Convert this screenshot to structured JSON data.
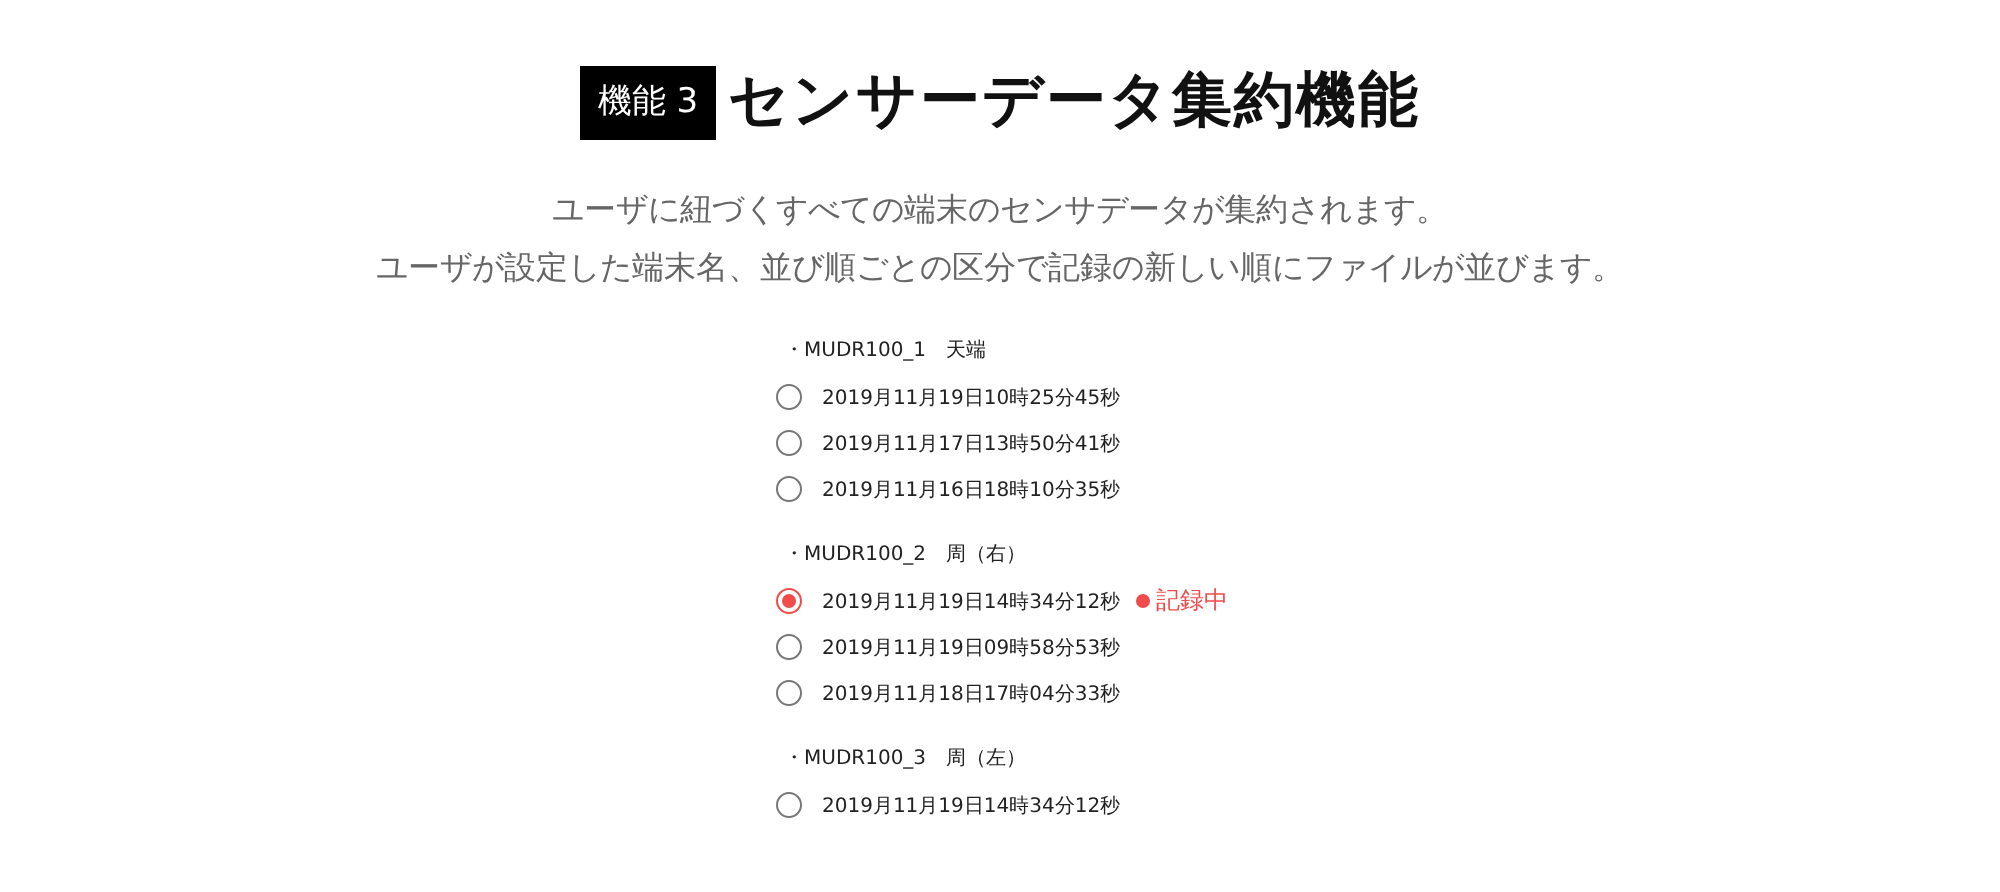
{
  "heading": {
    "badge": "機能 3",
    "title": "センサーデータ集約機能"
  },
  "description": [
    "ユーザに紐づくすべての端末のセンサデータが集約されます。",
    "ユーザが設定した端末名、並び順ごとの区分で記録の新しい順にファイルが並びます。"
  ],
  "groups": [
    {
      "label": "・MUDR100_1　天端",
      "files": [
        {
          "name": "2019月11月19日10時25分45秒",
          "selected": false
        },
        {
          "name": "2019月11月17日13時50分41秒",
          "selected": false
        },
        {
          "name": "2019月11月16日18時10分35秒",
          "selected": false
        }
      ]
    },
    {
      "label": "・MUDR100_2　周（右）",
      "files": [
        {
          "name": "2019月11月19日14時34分12秒",
          "selected": true,
          "status": "記録中"
        },
        {
          "name": "2019月11月19日09時58分53秒",
          "selected": false
        },
        {
          "name": "2019月11月18日17時04分33秒",
          "selected": false
        }
      ]
    },
    {
      "label": "・MUDR100_3　周（左）",
      "files": [
        {
          "name": "2019月11月19日14時34分12秒",
          "selected": false
        }
      ]
    }
  ]
}
